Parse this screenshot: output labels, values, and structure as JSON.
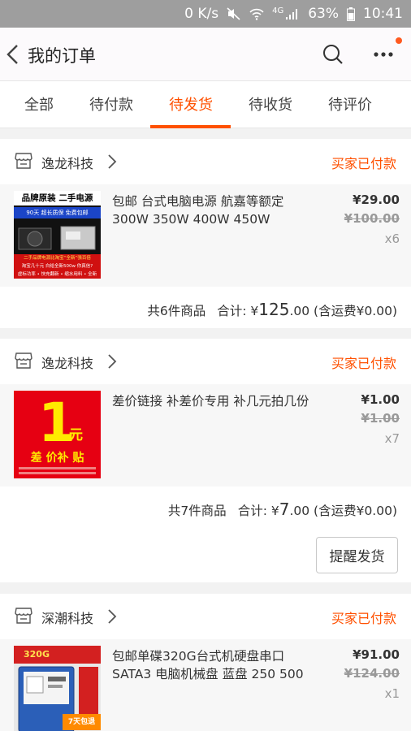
{
  "status_bar": {
    "speed": "0 K/s",
    "network": "4G",
    "battery": "63%",
    "time": "10:41"
  },
  "header": {
    "title": "我的订单",
    "search_icon": "search-icon",
    "more_icon": "more-icon"
  },
  "tabs": [
    {
      "label": "全部"
    },
    {
      "label": "待付款"
    },
    {
      "label": "待发货",
      "active": true
    },
    {
      "label": "待收货"
    },
    {
      "label": "待评价"
    }
  ],
  "orders": [
    {
      "shop": "逸龙科技",
      "status": "买家已付款",
      "item": {
        "title": "包邮 台式电脑电源 航嘉等额定300W 350W 400W 450W 500W…",
        "price": "¥29.00",
        "original_price": "¥100.00",
        "qty": "x6",
        "thumb": {
          "line1": "品牌原装 二手电源",
          "line2": "90天 超长质保 免费包邮",
          "line3": "二手品牌电源比淘宝“全新”强百倍",
          "line4": "淘宝几十元 白给全新500w 你真信?",
          "line5": "虚标功率 • 快充翻新 • 缩水用料 • 全新"
        }
      },
      "summary": {
        "count": "共6件商品",
        "total_label": "合计: ¥",
        "total": "125",
        "total_decimal": ".00",
        "shipping": "(含运费¥0.00)"
      }
    },
    {
      "shop": "逸龙科技",
      "status": "买家已付款",
      "item": {
        "title": "差价链接 补差价专用 补几元拍几份",
        "price": "¥1.00",
        "original_price": "¥1.00",
        "qty": "x7",
        "thumb": {
          "big": "1",
          "unit": "元",
          "caption": "差 价补 贴"
        }
      },
      "summary": {
        "count": "共7件商品",
        "total_label": "合计: ¥",
        "total": "7",
        "total_decimal": ".00",
        "shipping": "(含运费¥0.00)"
      },
      "action": "提醒发货"
    },
    {
      "shop": "深潮科技",
      "status": "买家已付款",
      "item": {
        "title": "包邮单碟320G台式机硬盘串口SATA3 电脑机械盘 蓝盘 250 500",
        "price": "¥91.00",
        "original_price": "¥124.00",
        "qty": "x1",
        "thumb": {
          "label": "320G",
          "tag": "7天包退"
        }
      }
    }
  ]
}
